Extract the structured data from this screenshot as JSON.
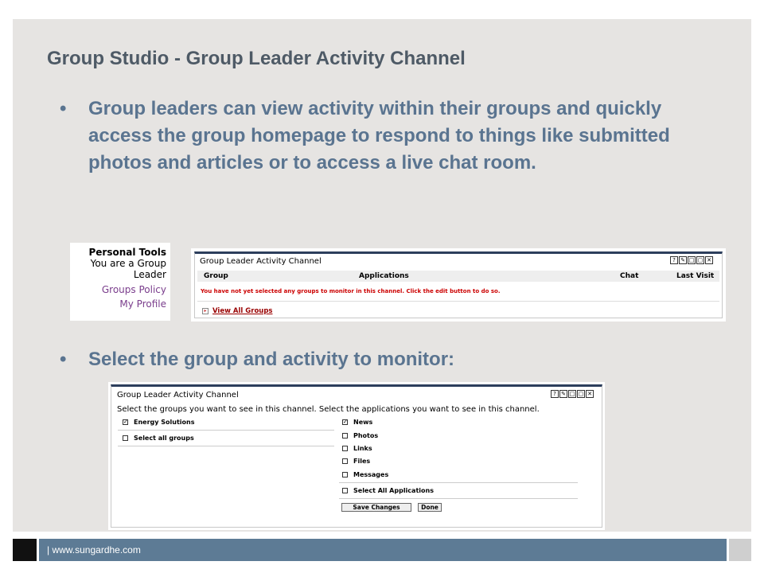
{
  "slide": {
    "title": "Group Studio - Group Leader Activity Channel",
    "bullet_char": "•",
    "bullets": [
      "Group leaders can view activity within their groups and quickly access the group homepage to respond to things like submitted photos and articles or to access a live chat room.",
      "Select the group and activity to monitor:"
    ]
  },
  "personal_tools": {
    "title": "Personal Tools",
    "subtitle": "You are a Group Leader",
    "links": [
      "Groups Policy",
      "My Profile"
    ]
  },
  "channel_view": {
    "title": "Group Leader Activity Channel",
    "icons": [
      "?",
      "✎",
      "□",
      "▢",
      "✕"
    ],
    "columns": [
      "Group",
      "Applications",
      "Chat",
      "Last Visit"
    ],
    "message": "You have not yet selected any groups to monitor in this channel. Click the edit button to do so.",
    "view_all_label": "View All Groups"
  },
  "channel_edit": {
    "title": "Group Leader Activity Channel",
    "icons": [
      "?",
      "✎",
      "□",
      "▢",
      "✕"
    ],
    "instructions": "Select the groups you want to see in this channel. Select the applications you want to see in this channel.",
    "groups": [
      {
        "label": "Energy Solutions",
        "checked": true
      },
      {
        "label": "Select all groups",
        "checked": false
      }
    ],
    "applications": [
      {
        "label": "News",
        "checked": true
      },
      {
        "label": "Photos",
        "checked": false
      },
      {
        "label": "Links",
        "checked": false
      },
      {
        "label": "Files",
        "checked": false
      },
      {
        "label": "Messages",
        "checked": false
      },
      {
        "label": "Select All Applications",
        "checked": false
      }
    ],
    "save_label": "Save Changes",
    "done_label": "Done"
  },
  "footer": {
    "text": "| www.sungardhe.com"
  },
  "colors": {
    "slide_bg": "#e6e4e2",
    "title": "#4e5a66",
    "bullet": "#5a7490",
    "footer_bar": "#5d7b95",
    "portlet_border": "#2c3e5c",
    "warning": "#cc0000",
    "link": "#7a3d8c"
  }
}
